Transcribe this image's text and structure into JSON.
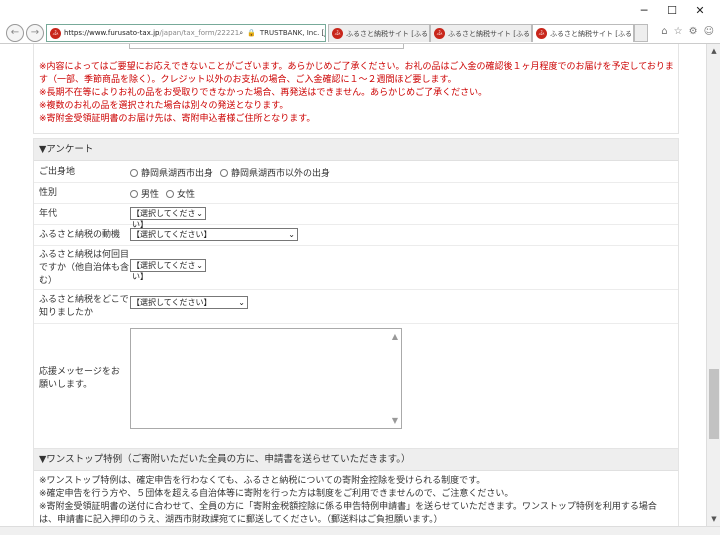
{
  "window": {
    "minimize": "─",
    "maximize": "☐",
    "close": "✕"
  },
  "toolbar": {
    "back": "←",
    "forward": "→",
    "url_base": "https://www.furusato-tax.jp",
    "url_path": "/japan/tax_form/22221",
    "search_glyph": "⌕",
    "cert": "TRUSTBANK, Inc. [JP]",
    "refresh": "↻",
    "tabs": [
      {
        "label": "ふるさと納税サイト [ふるさとチョイ...",
        "active": false
      },
      {
        "label": "ふるさと納税サイト [ふるさとチョイ...",
        "active": false
      },
      {
        "label": "ふるさと納税サイト [ふるさとチ...",
        "active": true
      }
    ],
    "tab_close": "✕",
    "home": "⌂",
    "star": "☆",
    "gear": "⚙",
    "smiley": "☺"
  },
  "notes": [
    "※内容によってはご要望にお応えできないことがございます。あらかじめご了承ください。お礼の品はご入金の確認後１ヶ月程度でのお届けを予定しております（一部、季節商品を除く）。クレジット以外のお支払の場合、ご入金確認に１～２週間ほど要します。",
    "※長期不在等によりお礼の品をお受取りできなかった場合、再発送はできません。あらかじめご了承ください。",
    "※複数のお礼の品を選択された場合は別々の発送となります。",
    "※寄附金受領証明書のお届け先は、寄附申込者様ご住所となります。"
  ],
  "survey": {
    "heading": "▼アンケート",
    "birthplace": {
      "label": "ご出身地",
      "options": [
        "静岡県湖西市出身",
        "静岡県湖西市以外の出身"
      ]
    },
    "gender": {
      "label": "性別",
      "options": [
        "男性",
        "女性"
      ]
    },
    "age": {
      "label": "年代",
      "value": "【選択してください】"
    },
    "motive": {
      "label": "ふるさと納税の動機",
      "value": "【選択してください】"
    },
    "count": {
      "label": "ふるさと納税は何回目ですか（他自治体も含む）",
      "value": "【選択してください】"
    },
    "source": {
      "label": "ふるさと納税をどこで知りましたか",
      "value": "【選択してください】"
    },
    "message": {
      "label": "応援メッセージをお願いします。"
    }
  },
  "onestop": {
    "heading": "▼ワンストップ特例（ご寄附いただいた全員の方に、申請書を送らせていただきます。）",
    "notes": [
      "※ワンストップ特例は、確定申告を行わなくても、ふるさと納税についての寄附金控除を受けられる制度です。",
      "※確定申告を行う方や、５団体を超える自治体等に寄附を行った方は制度をご利用できませんので、ご注意ください。",
      "※寄附金受領証明書の送付に合わせて、全員の方に「寄附金税額控除に係る申告特例申請書」を送らせていただきます。ワンストップ特例を利用する場合は、申請書に記入押印のうえ、湖西市財政課宛てに郵送してください。（郵送料はご負担願います。）"
    ]
  },
  "scroll": {
    "up": "▲",
    "down": "▼"
  }
}
